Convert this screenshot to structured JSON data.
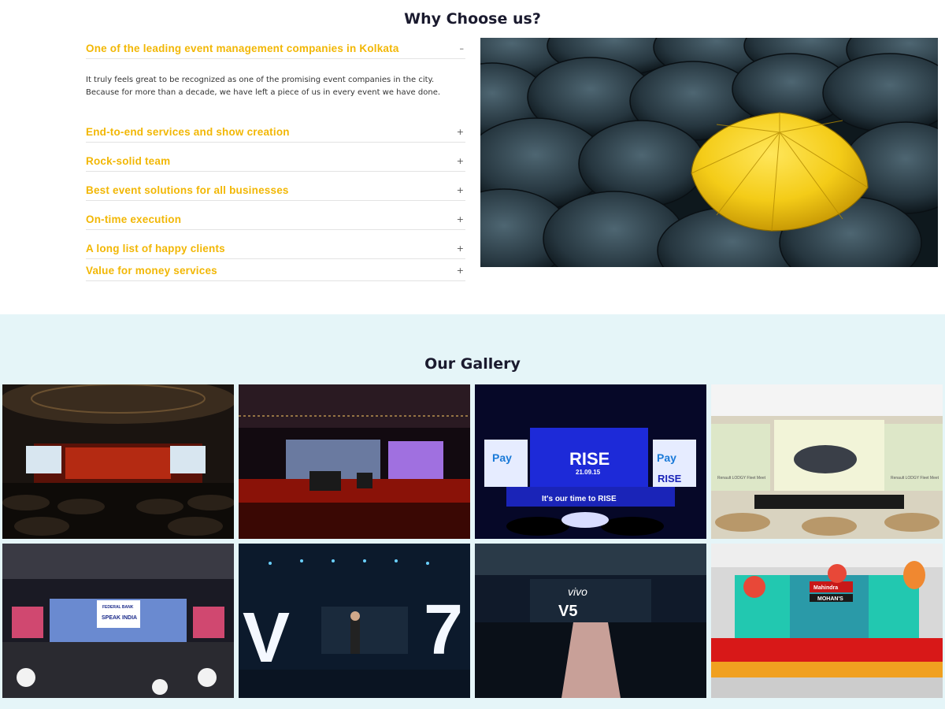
{
  "why": {
    "title": "Why Choose us?",
    "items": [
      {
        "title": "One of the leading event management companies in Kolkata",
        "sign": "–",
        "open": true,
        "body": "It truly feels great to be recognized as one of the promising event companies in the city. Because for more than a decade, we have left a piece of us in every event we have done."
      },
      {
        "title": "End-to-end services and show creation",
        "sign": "+"
      },
      {
        "title": "Rock-solid team",
        "sign": "+"
      },
      {
        "title": "Best event solutions for all businesses",
        "sign": "+"
      },
      {
        "title": "On-time execution",
        "sign": "+"
      },
      {
        "title": "A long list of happy clients",
        "sign": "+"
      },
      {
        "title": "Value for money services",
        "sign": "+"
      }
    ]
  },
  "gallery": {
    "title": "Our Gallery",
    "tiles": [
      {
        "name": "federal-bank-hall-stage"
      },
      {
        "name": "music-stage-red-lights"
      },
      {
        "name": "paytm-rise-stage",
        "texts": [
          "Pay",
          "RISE",
          "21.09.15",
          "It's our time to RISE",
          "Pay",
          "RISE"
        ]
      },
      {
        "name": "renault-lodgy-fleet-meet",
        "texts": [
          "Renault LODGY Fleet Meet",
          "Renault LODGY Fleet Meet"
        ]
      },
      {
        "name": "federal-bank-speak-india",
        "texts": [
          "FEDERAL BANK",
          "SPEAK INDIA"
        ]
      },
      {
        "name": "vivo-v7-launch",
        "texts": [
          "V",
          "7"
        ]
      },
      {
        "name": "vivo-v5-auditorium",
        "texts": [
          "vivo",
          "V5"
        ]
      },
      {
        "name": "mahindra-mohans-stage",
        "texts": [
          "Mahindra",
          "MOHAN'S"
        ]
      }
    ]
  }
}
